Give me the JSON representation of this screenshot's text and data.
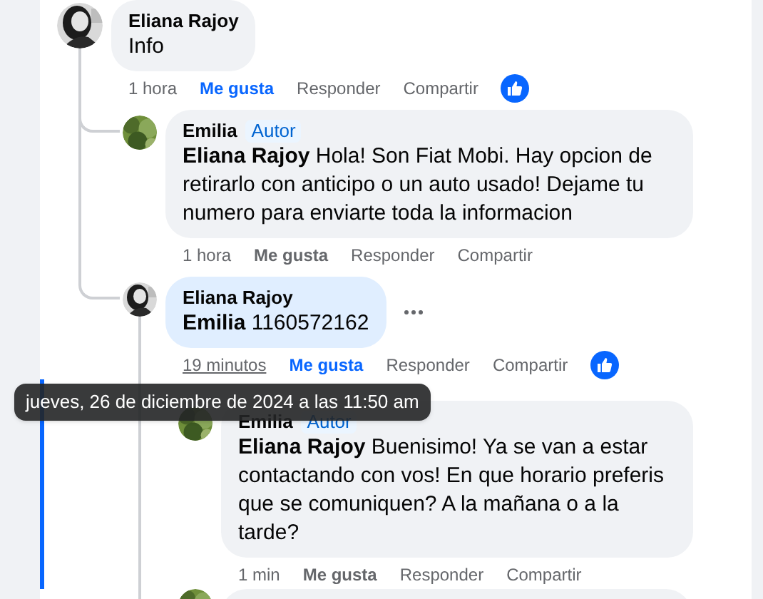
{
  "comments": [
    {
      "author": "Eliana Rajoy",
      "text": "Info",
      "time": "1 hora",
      "time_hovered": false,
      "like_label": "Me gusta",
      "liked": true,
      "reply_label": "Responder",
      "share_label": "Compartir",
      "reacted": true,
      "bubble_highlighted": false,
      "menu": false,
      "indicator": false,
      "children": [
        {
          "author": "Emilia",
          "badge": "Autor",
          "text": "**Eliana Rajoy** Hola! Son Fiat Mobi. Hay opcion de retirarlo con anticipo o un auto usado! Dejame tu numero para enviarte toda la informacion",
          "time": "1 hora",
          "time_hovered": false,
          "like_label": "Me gusta",
          "liked": false,
          "reply_label": "Responder",
          "share_label": "Compartir",
          "reacted": false,
          "bubble_highlighted": false,
          "menu": false,
          "indicator": false
        },
        {
          "author": "Eliana Rajoy",
          "text": "**Emilia** 1160572162",
          "time": "19 minutos",
          "time_hovered": true,
          "like_label": "Me gusta",
          "liked": true,
          "reply_label": "Responder",
          "share_label": "Compartir",
          "reacted": true,
          "bubble_highlighted": true,
          "menu": true,
          "indicator": false,
          "children": [
            {
              "author": "Emilia",
              "badge": "Autor",
              "text": "**Eliana Rajoy** Buenisimo! Ya se van a estar contactando con vos! En que horario preferis que se comuniquen? A la mañana o a la tarde?",
              "time": "1 min",
              "time_hovered": false,
              "like_label": "Me gusta",
              "liked": false,
              "reply_label": "Responder",
              "share_label": "Compartir",
              "reacted": false,
              "bubble_highlighted": false,
              "menu": false,
              "indicator": true
            },
            {
              "cut_off": true
            }
          ]
        }
      ]
    }
  ],
  "tooltip": {
    "text": "jueves, 26 de diciembre de 2024 a las 11:50 am"
  }
}
